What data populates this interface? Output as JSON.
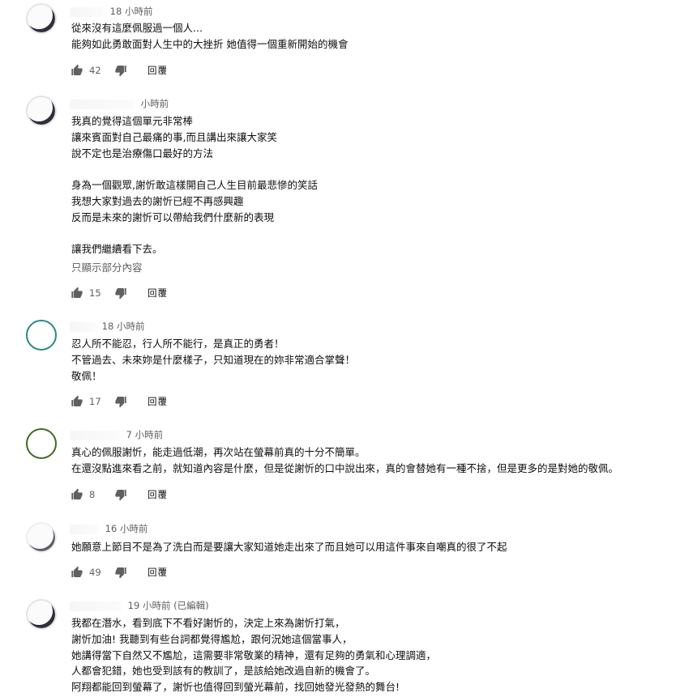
{
  "comments": [
    {
      "time": "18 小時前",
      "lines": [
        "從來沒有這麼佩服過一個人...",
        "能夠如此勇敢面對人生中的大挫折 她值得一個重新開始的機會"
      ],
      "likes": "42",
      "reply_label": "回覆"
    },
    {
      "time": "小時前",
      "lines": [
        "我真的覺得這個單元非常棒",
        "讓來賓面對自己最痛的事,而且講出來讓大家笑",
        "說不定也是治療傷口最好的方法",
        "",
        "身為一個觀眾,謝忻敢這樣開自己人生目前最悲慘的笑話",
        "我想大家對過去的謝忻已經不再感興趣",
        "反而是未來的謝忻可以帶給我們什麼新的表現",
        "",
        "讓我們繼續看下去。"
      ],
      "show_more": "只顯示部分內容",
      "likes": "15",
      "reply_label": "回覆"
    },
    {
      "time": "18 小時前",
      "lines": [
        "忍人所不能忍，行人所不能行，是真正的勇者！",
        "不管過去、未來妳是什麼樣子，只知道現在的妳非常適合掌聲！",
        "敬佩！"
      ],
      "likes": "17",
      "reply_label": "回覆"
    },
    {
      "time": "7 小時前",
      "lines": [
        "真心的佩服謝忻，能走過低潮，再次站在螢幕前真的十分不簡單。",
        "在還沒點進來看之前，就知道內容是什麼，但是從謝忻的口中說出來，真的會替她有一種不捨，但是更多的是對她的敬佩。"
      ],
      "likes": "8",
      "reply_label": "回覆"
    },
    {
      "time": "16 小時前",
      "lines": [
        "她願意上節目不是為了洗白而是要讓大家知道她走出來了而且她可以用這件事來自嘲真的很了不起"
      ],
      "likes": "49",
      "reply_label": "回覆"
    },
    {
      "time": "19 小時前 (已編輯)",
      "lines": [
        "我都在潛水，看到底下不看好謝忻的，決定上來為謝忻打氣，",
        "謝忻加油! 我聽到有些台詞都覺得尷尬，跟何況她這個當事人，",
        "她講得當下自然又不尷尬，這需要非常敬業的精神，還有足夠的勇氣和心理調適，",
        "人都會犯錯，她也受到該有的教訓了，是該給她改過自新的機會了。",
        "阿翔都能回到螢幕了，謝忻也值得回到螢光幕前，找回她發光發熱的舞台!"
      ]
    }
  ]
}
